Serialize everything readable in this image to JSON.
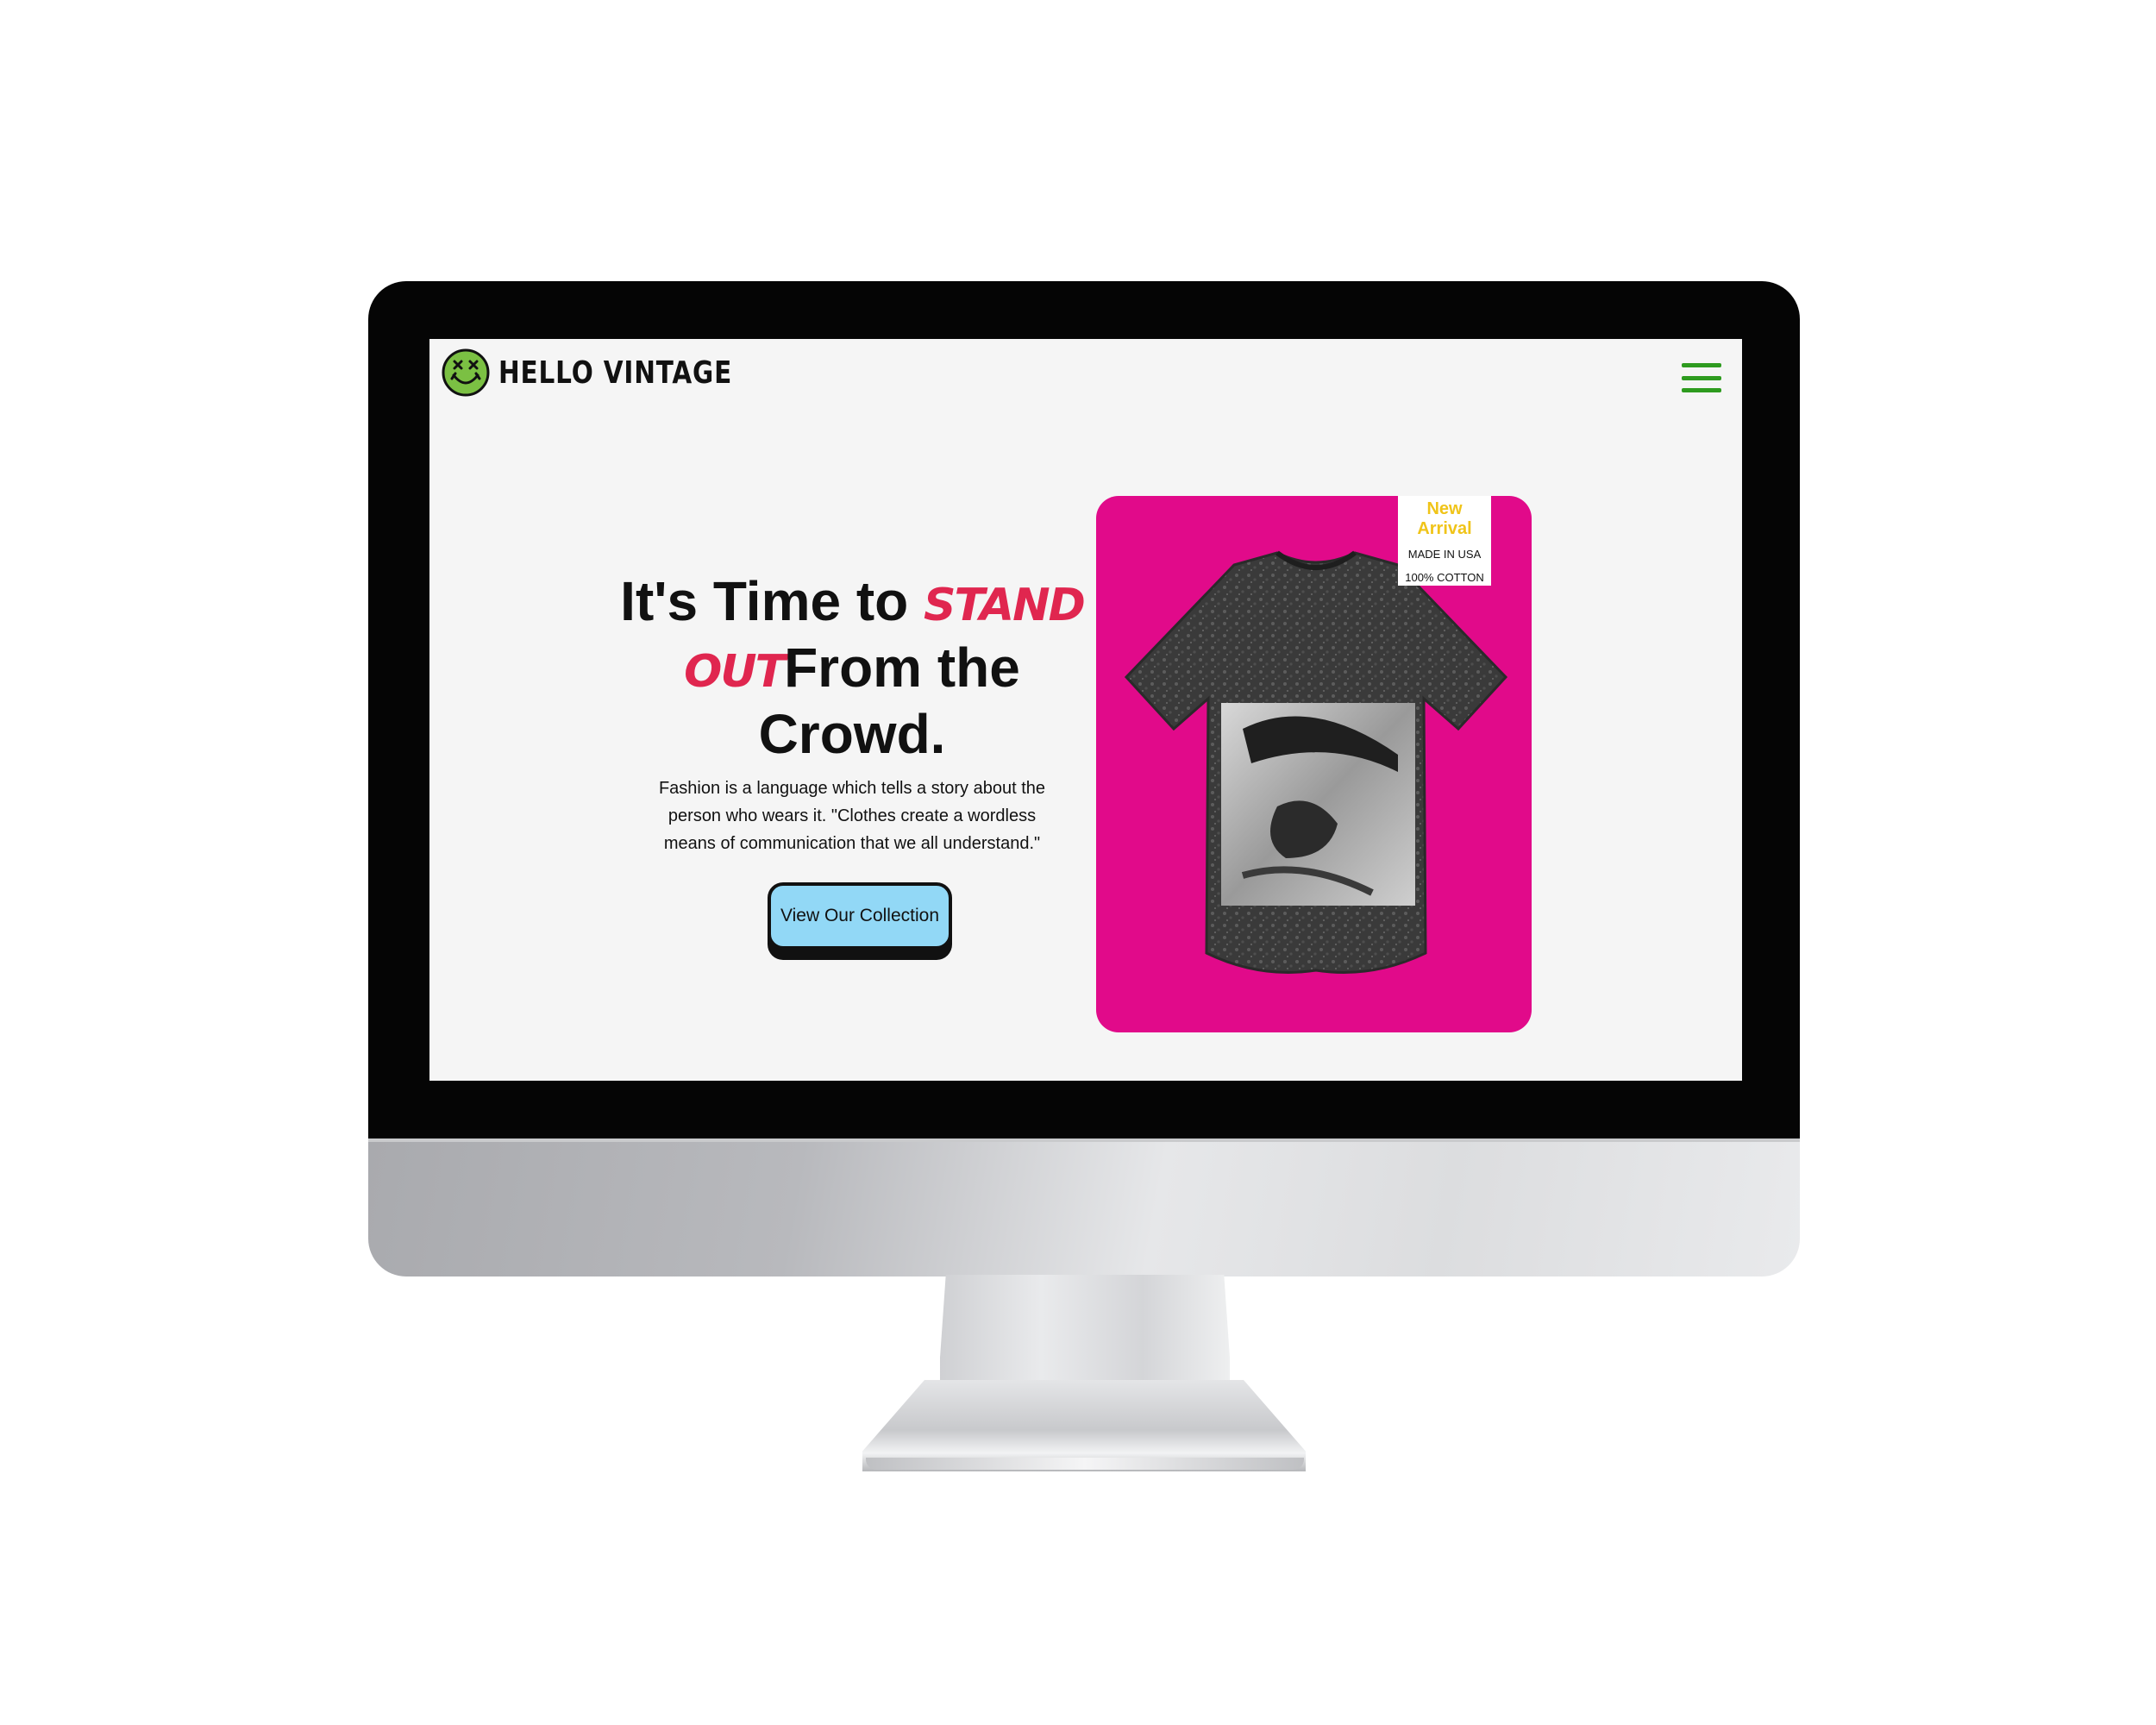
{
  "brand": {
    "name": "HELLO VINTAGE",
    "logo_color": "#7bc043",
    "icon": "dizzy-smiley-face-icon"
  },
  "nav": {
    "menu_icon": "hamburger-menu-icon",
    "menu_color": "#2e9b1f"
  },
  "hero": {
    "title_part1": "It's Time to",
    "title_accent1": "STAND",
    "title_accent2": "OUT",
    "title_part2": "From the Crowd.",
    "accent_color": "#e0264f",
    "description": "Fashion is a language which tells a story about the person who wears it. \"Clothes create a wordless means of communication that we all understand.\"",
    "cta_label": "View Our Collection",
    "cta_color": "#92d8f6"
  },
  "product": {
    "card_color": "#e10a8a",
    "tag_title": "New Arrival",
    "tag_line1": "MADE IN USA",
    "tag_line2": "100% COTTON",
    "tag_title_color": "#f0c419"
  }
}
